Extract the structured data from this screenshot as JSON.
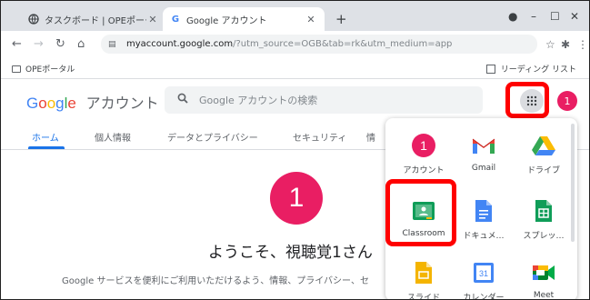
{
  "browser": {
    "tabs": [
      {
        "title": "タスクボード | OPEポータル",
        "active": false
      },
      {
        "title": "Google アカウント",
        "active": true
      }
    ],
    "new_tab_icon": "plus-icon",
    "url_host": "myaccount.google.com",
    "url_path": "/?utm_source=OGB&tab=rk&utm_medium=app",
    "bookmark": "OPEポータル",
    "reading_list": "リーディング リスト"
  },
  "header": {
    "logo_letters": [
      "G",
      "o",
      "o",
      "g",
      "l",
      "e"
    ],
    "account_label": "アカウント",
    "search_placeholder": "Google アカウントの検索",
    "avatar_initial": "1"
  },
  "nav": {
    "tabs": [
      "ホーム",
      "個人情報",
      "データとプライバシー",
      "セキュリティ",
      "情"
    ]
  },
  "main": {
    "avatar_initial": "1",
    "welcome": "ようこそ、視聴覚1さん",
    "subtitle": "Google サービスを便利にご利用いただけるよう、情報、プライバシー、セ"
  },
  "apps": [
    {
      "label": "アカウント",
      "icon": "account-icon"
    },
    {
      "label": "Gmail",
      "icon": "gmail-icon"
    },
    {
      "label": "ドライブ",
      "icon": "drive-icon"
    },
    {
      "label": "Classroom",
      "icon": "classroom-icon"
    },
    {
      "label": "ドキュメ…",
      "icon": "docs-icon"
    },
    {
      "label": "スプレッ…",
      "icon": "sheets-icon"
    },
    {
      "label": "スライド",
      "icon": "slides-icon"
    },
    {
      "label": "カレンダー",
      "icon": "calendar-icon"
    },
    {
      "label": "Meet",
      "icon": "meet-icon"
    }
  ],
  "calendar_day": "31",
  "colors": {
    "highlight": "#ff0000",
    "accent_blue": "#1a73e8",
    "avatar_pink": "#e91e63"
  }
}
